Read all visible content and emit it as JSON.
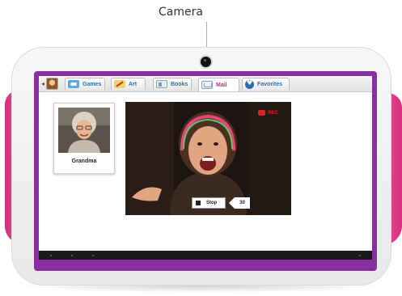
{
  "annotation": {
    "callout_label": "Camera"
  },
  "tabs": [
    {
      "label": "Games",
      "icon": "gamepad-icon",
      "active": false
    },
    {
      "label": "Art",
      "icon": "paintbrush-icon",
      "active": false
    },
    {
      "label": "Books",
      "icon": "book-icon",
      "active": false
    },
    {
      "label": "Mail",
      "icon": "mail-icon",
      "active": true
    },
    {
      "label": "Favorites",
      "icon": "heart-icon",
      "active": false
    }
  ],
  "contact": {
    "name": "Grandma"
  },
  "video": {
    "stop_label": "Stop",
    "timer_value": "30",
    "rec_label": "REC"
  },
  "colors": {
    "frame_purple": "#8a2f9f",
    "bumper_pink": "#e0458b",
    "tab_text_blue": "#2a6fb3",
    "active_tab_text": "#b23393",
    "record_red": "#e02020"
  }
}
